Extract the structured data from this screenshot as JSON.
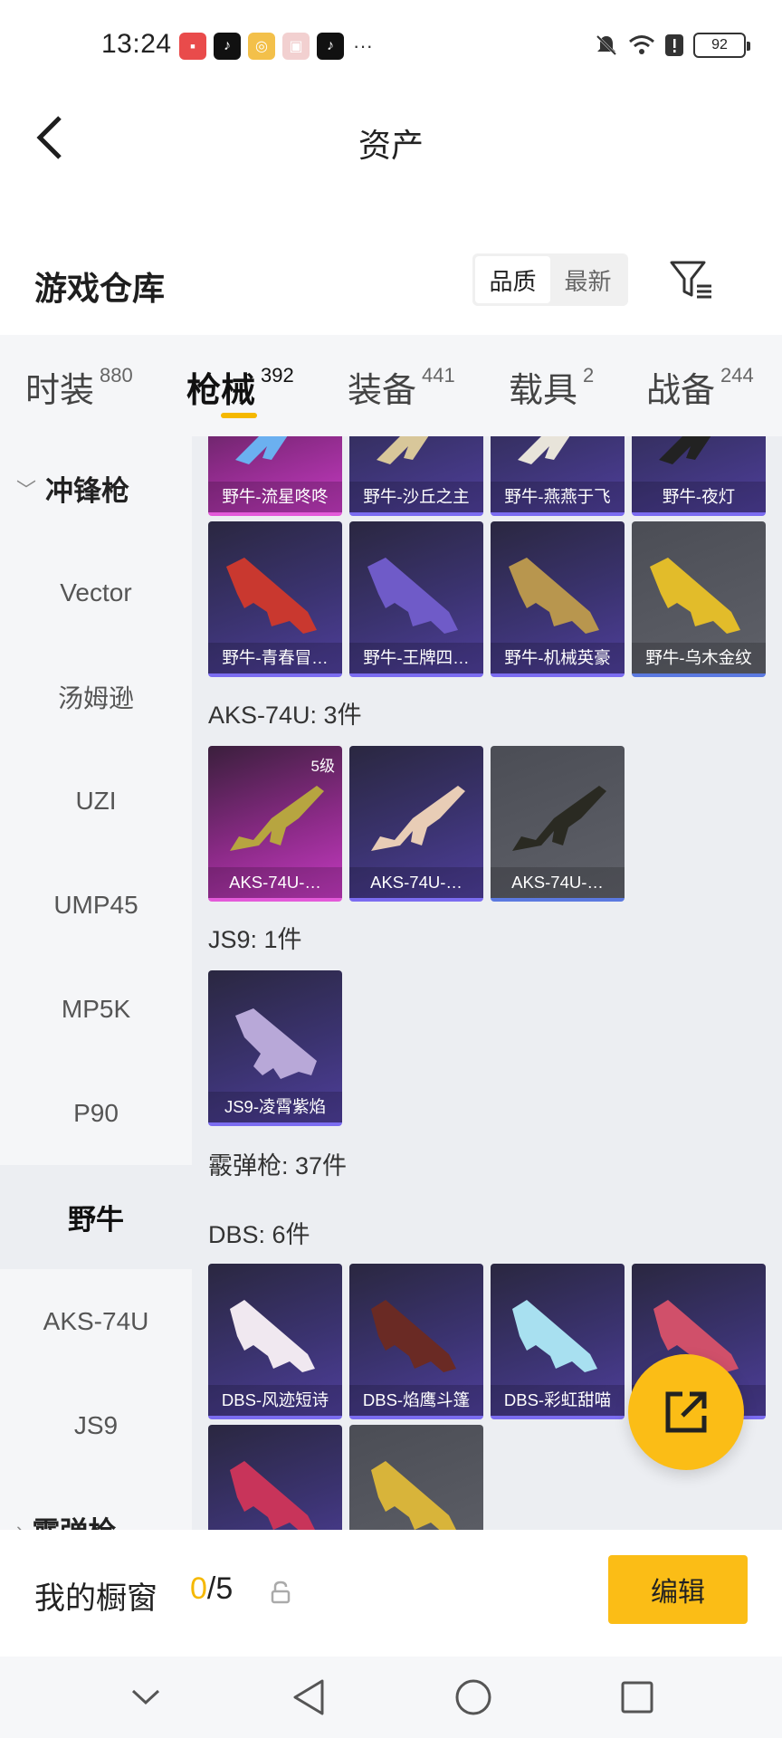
{
  "status_bar": {
    "time": "13:24",
    "more": "···",
    "battery": "92"
  },
  "header": {
    "title": "资产"
  },
  "warehouse": {
    "title": "游戏仓库",
    "sort_options": [
      "品质",
      "最新"
    ],
    "active_sort": "品质"
  },
  "tabs": [
    {
      "label": "时装",
      "count": "880"
    },
    {
      "label": "枪械",
      "count": "392"
    },
    {
      "label": "装备",
      "count": "441"
    },
    {
      "label": "载具",
      "count": "2"
    },
    {
      "label": "战备",
      "count": "244"
    }
  ],
  "active_tab": "枪械",
  "sidebar": {
    "group": "冲锋枪",
    "items": [
      "Vector",
      "汤姆逊",
      "UZI",
      "UMP45",
      "MP5K",
      "P90",
      "野牛",
      "AKS-74U",
      "JS9"
    ],
    "active": "野牛",
    "next_group": "霰弹枪"
  },
  "content": {
    "bizon_row1": [
      {
        "name": "野牛-流星咚咚",
        "rarity": "pink"
      },
      {
        "name": "野牛-沙丘之主",
        "rarity": "purple"
      },
      {
        "name": "野牛-燕燕于飞",
        "rarity": "purple"
      },
      {
        "name": "野牛-夜灯",
        "rarity": "purple"
      }
    ],
    "bizon_row2": [
      {
        "name": "野牛-青春冒…",
        "rarity": "purple"
      },
      {
        "name": "野牛-王牌四…",
        "rarity": "purple"
      },
      {
        "name": "野牛-机械英豪",
        "rarity": "purple"
      },
      {
        "name": "野牛-乌木金纹",
        "rarity": "gray"
      }
    ],
    "aks_label": "AKS-74U: 3件",
    "aks_items": [
      {
        "name": "AKS-74U-…",
        "rarity": "pink",
        "level": "5级"
      },
      {
        "name": "AKS-74U-…",
        "rarity": "purple"
      },
      {
        "name": "AKS-74U-…",
        "rarity": "gray"
      }
    ],
    "js9_label": "JS9: 1件",
    "js9_items": [
      {
        "name": "JS9-凌霄紫焰",
        "rarity": "purple"
      }
    ],
    "shotgun_label": "霰弹枪: 37件",
    "dbs_label": "DBS: 6件",
    "dbs_items": [
      {
        "name": "DBS-风迹短诗",
        "rarity": "purple"
      },
      {
        "name": "DBS-焰鹰斗篷",
        "rarity": "purple"
      },
      {
        "name": "DBS-彩虹甜喵",
        "rarity": "purple"
      },
      {
        "name": "DBS-…梦",
        "rarity": "purple"
      }
    ],
    "dbs_items_row2": [
      {
        "name": "",
        "rarity": "purple"
      },
      {
        "name": "",
        "rarity": "gray"
      }
    ]
  },
  "showcase": {
    "label": "我的橱窗",
    "current": "0",
    "total": "/5",
    "edit_label": "编辑"
  },
  "colors": {
    "accent": "#fbbd16",
    "rarity_pink": "#c33ac0",
    "rarity_purple": "#4e3e9a",
    "rarity_gray": "#5f6169"
  }
}
